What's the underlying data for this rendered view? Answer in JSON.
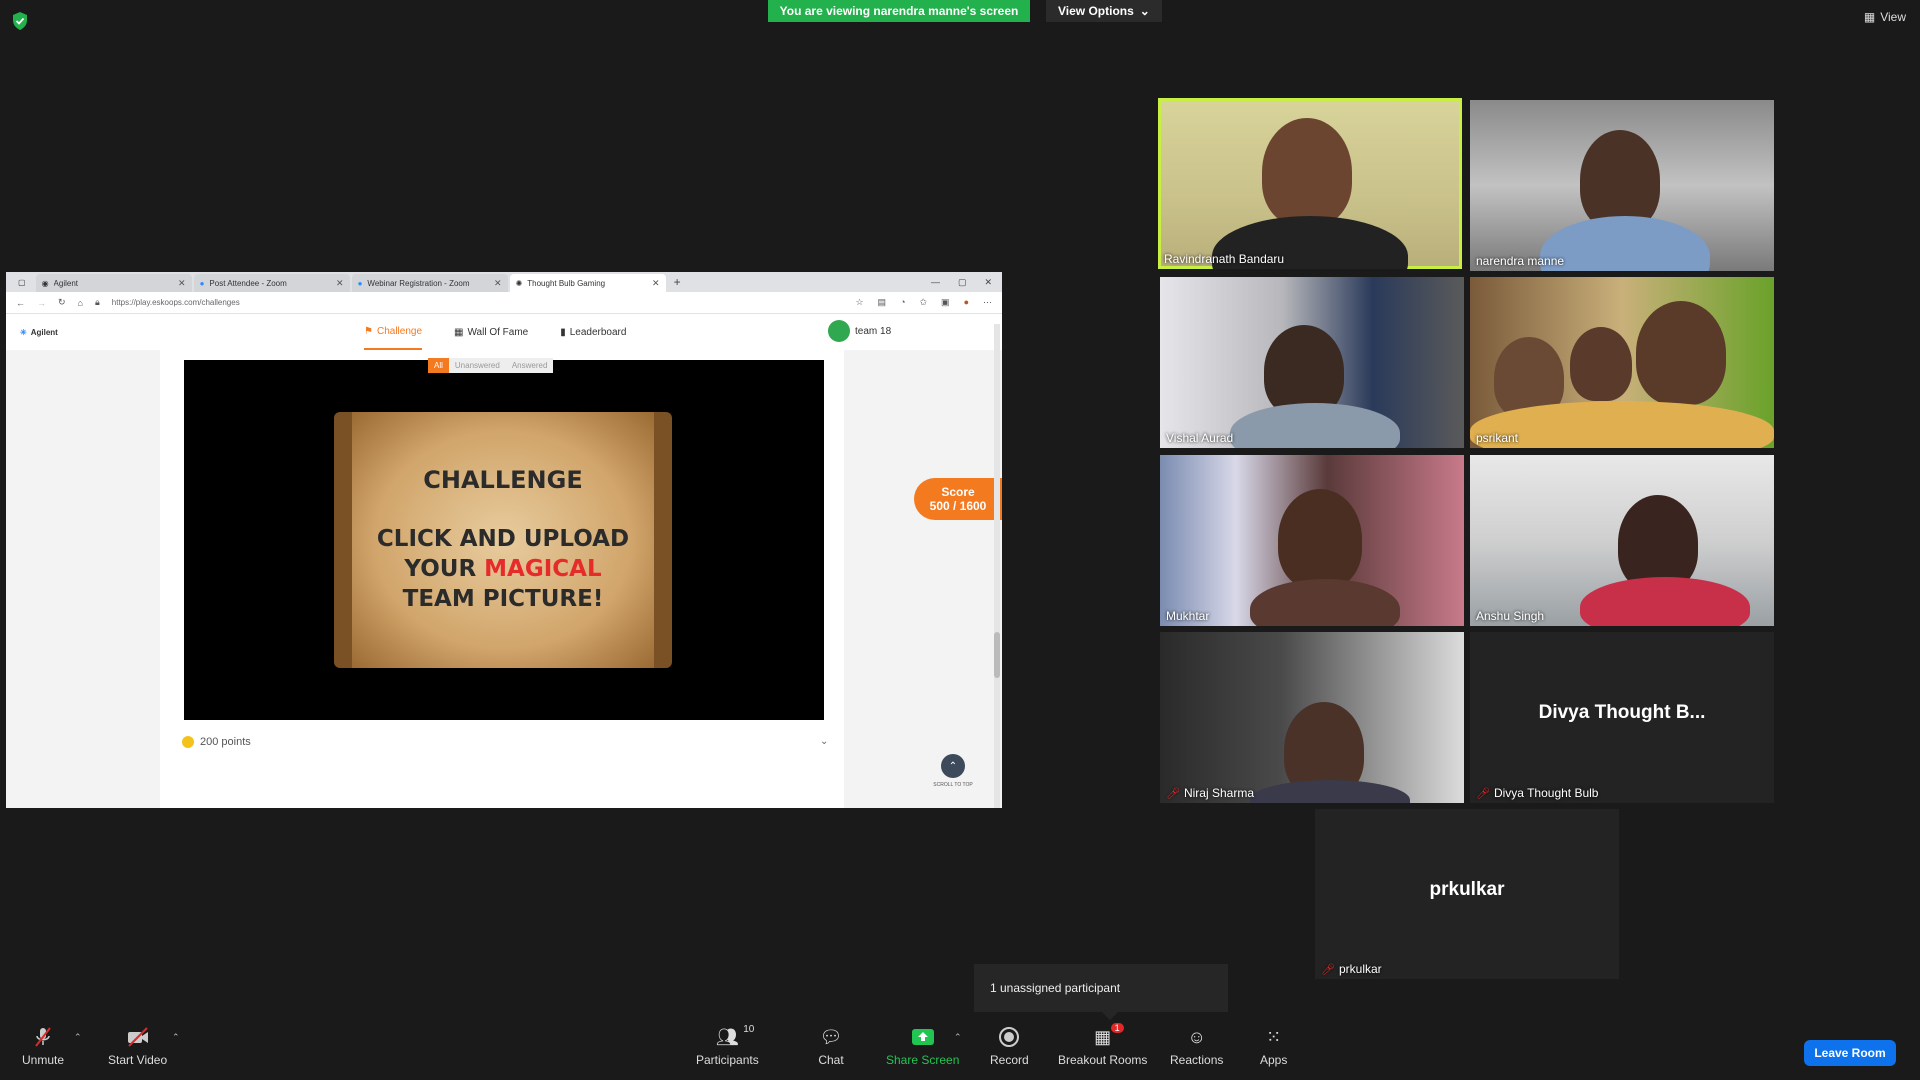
{
  "banner": {
    "viewing": "You are viewing narendra manne's screen",
    "view_options": "View Options",
    "view": "View"
  },
  "browser": {
    "tabs": [
      {
        "label": "Agilent"
      },
      {
        "label": "Post Attendee - Zoom"
      },
      {
        "label": "Webinar Registration - Zoom"
      },
      {
        "label": "Thought Bulb Gaming"
      }
    ],
    "url": "https://play.eskoops.com/challenges",
    "brand": "Agilent",
    "nav": {
      "challenge": "Challenge",
      "wall": "Wall Of Fame",
      "leaderboard": "Leaderboard"
    },
    "team": "team 18",
    "filters": {
      "all": "All",
      "unanswered": "Unanswered",
      "answered": "Answered"
    },
    "challenge": {
      "title": "CHALLENGE",
      "line1": "CLICK AND UPLOAD",
      "line2a": "YOUR ",
      "line2b": "MAGICAL",
      "line3": "TEAM PICTURE!"
    },
    "points": "200 points",
    "score_label": "Score",
    "score_value": "500 / 1600",
    "scroll_to_top": "SCROLL TO TOP"
  },
  "participants": [
    {
      "name": "Ravindranath Bandaru",
      "muted": false
    },
    {
      "name": "narendra manne",
      "muted": false
    },
    {
      "name": "Vishal Aurad",
      "muted": false
    },
    {
      "name": "psrikant",
      "muted": false
    },
    {
      "name": "Mukhtar",
      "muted": false
    },
    {
      "name": "Anshu Singh",
      "muted": false
    },
    {
      "name": "Niraj Sharma",
      "muted": true
    },
    {
      "name": "Divya Thought Bulb",
      "display": "Divya Thought B...",
      "muted": true
    },
    {
      "name": "prkulkar",
      "display": "prkulkar",
      "muted": true
    }
  ],
  "tooltip": "1 unassigned participant",
  "toolbar": {
    "unmute": "Unmute",
    "start_video": "Start Video",
    "participants": "Participants",
    "participants_count": "10",
    "chat": "Chat",
    "share_screen": "Share Screen",
    "record": "Record",
    "breakout": "Breakout Rooms",
    "breakout_badge": "1",
    "reactions": "Reactions",
    "apps": "Apps",
    "leave": "Leave Room"
  },
  "colors": {
    "accent_green": "#23b14d",
    "brand_orange": "#f47a20",
    "leave_blue": "#0e72ed",
    "speaker_outline": "#c8ef44"
  }
}
